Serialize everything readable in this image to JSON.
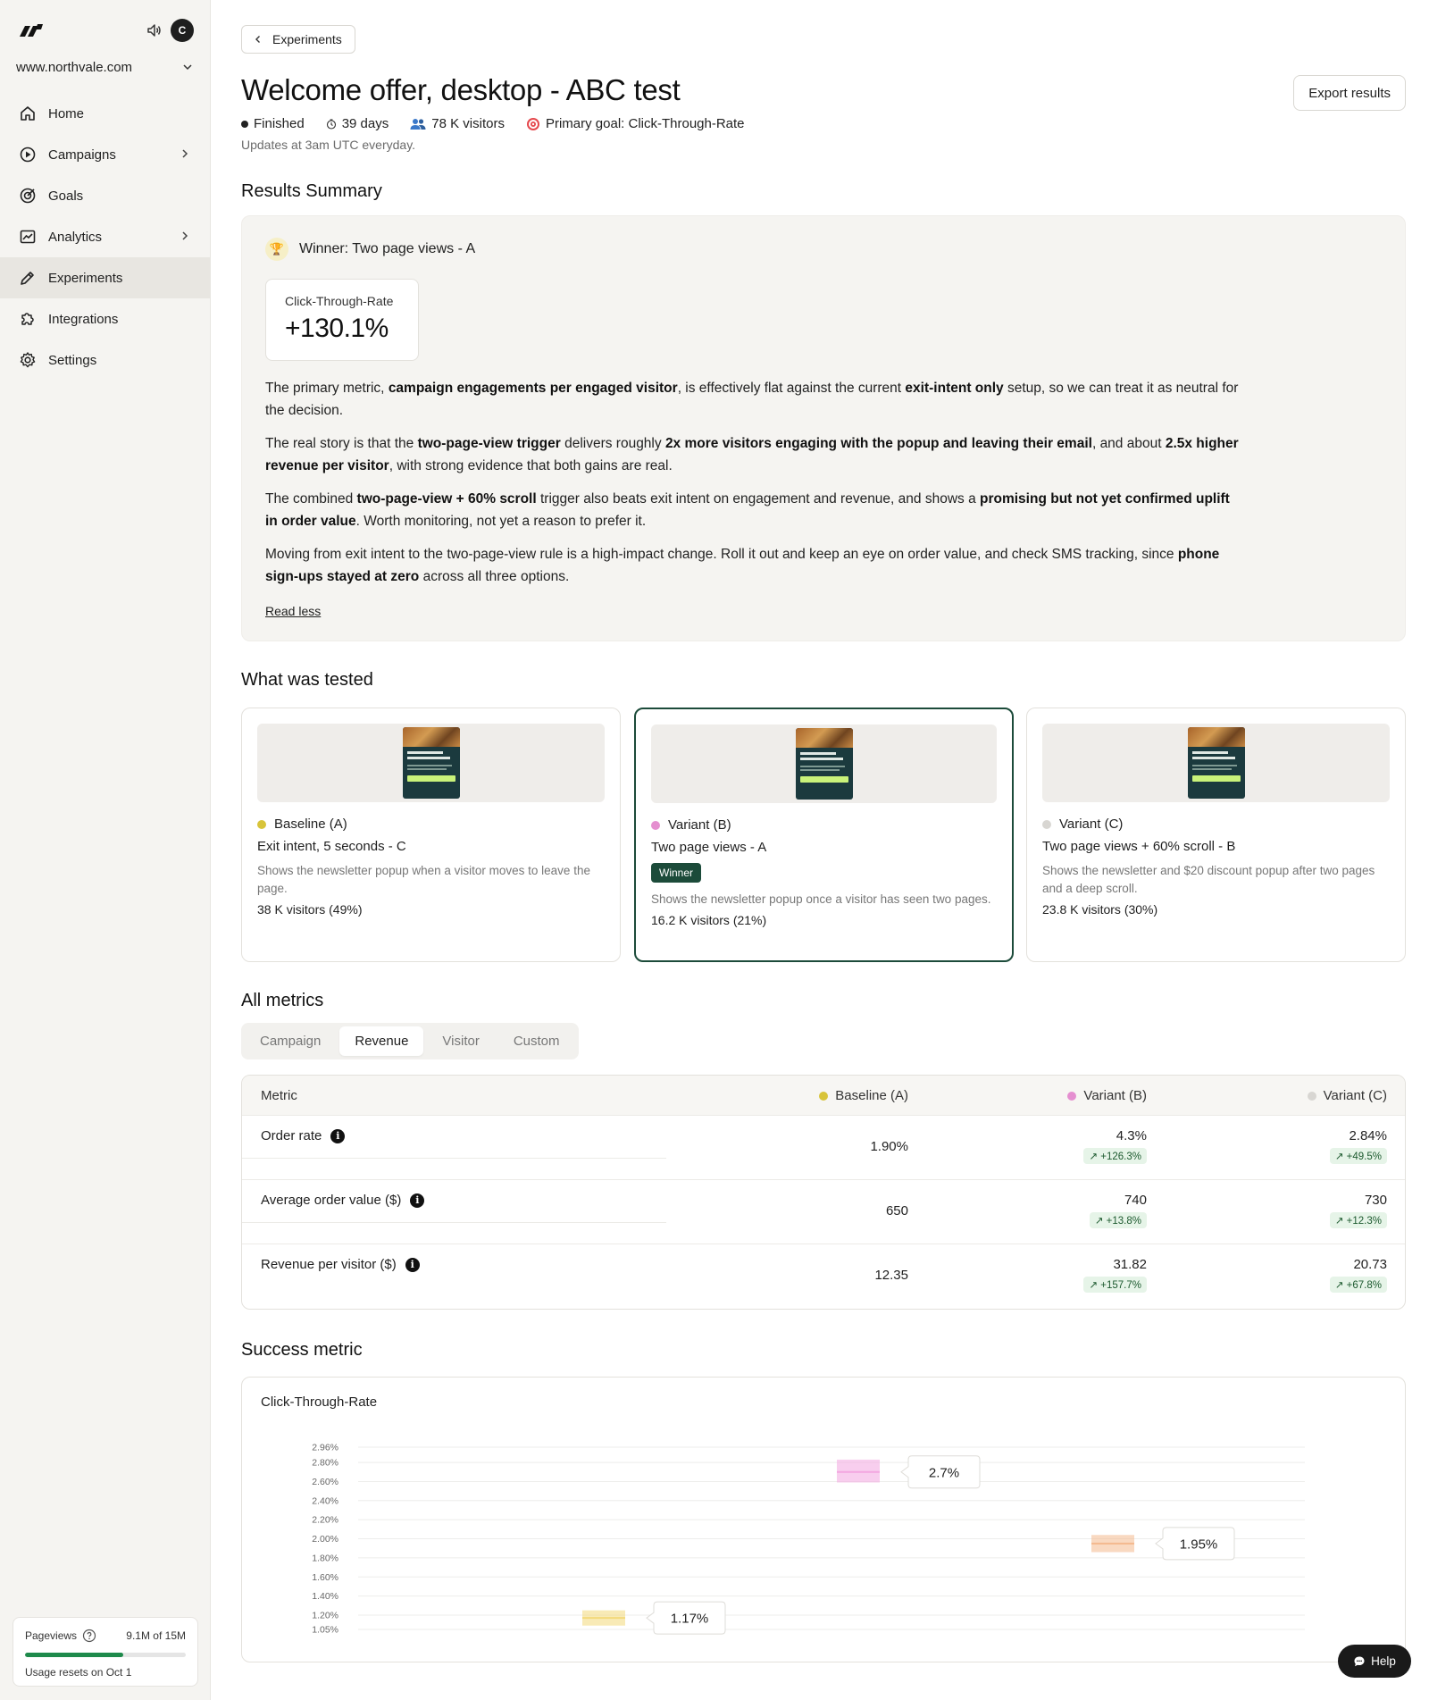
{
  "sidebar": {
    "site": "www.northvale.com",
    "avatar": "C",
    "items": [
      {
        "label": "Home",
        "icon": "home-icon"
      },
      {
        "label": "Campaigns",
        "icon": "campaigns-icon"
      },
      {
        "label": "Goals",
        "icon": "goals-icon"
      },
      {
        "label": "Analytics",
        "icon": "analytics-icon"
      },
      {
        "label": "Experiments",
        "icon": "experiments-icon"
      },
      {
        "label": "Integrations",
        "icon": "integrations-icon"
      },
      {
        "label": "Settings",
        "icon": "settings-icon"
      }
    ],
    "usage": {
      "label": "Pageviews",
      "value": "9.1M of 15M",
      "fraction": 0.61,
      "reset": "Usage resets on Oct 1"
    }
  },
  "header": {
    "back_label": "Experiments",
    "title": "Welcome offer, desktop - ABC test",
    "export_label": "Export results",
    "status": "Finished",
    "duration": "39 days",
    "visitors": "78 K visitors",
    "goal": "Primary goal: Click-Through-Rate",
    "updates": "Updates at 3am UTC everyday."
  },
  "summary": {
    "section_title": "Results Summary",
    "winner": "Winner: Two page views - A",
    "metric_label": "Click-Through-Rate",
    "metric_value": "+130.1%",
    "p1": {
      "a": "The primary metric, ",
      "b": "campaign engagements per engaged visitor",
      "c": ", is effectively flat against the current ",
      "d": "exit-intent only",
      "e": " setup, so we can treat it as neutral for the decision."
    },
    "p2": {
      "a": "The real story is that the ",
      "b": "two-page-view trigger",
      "c": " delivers roughly ",
      "d": "2x more visitors engaging with the popup and leaving their email",
      "e": ", and about ",
      "f": "2.5x higher revenue per visitor",
      "g": ", with strong evidence that both gains are real."
    },
    "p3": {
      "a": "The combined ",
      "b": "two-page-view + 60% scroll",
      "c": " trigger also beats exit intent on engagement and revenue, and shows a ",
      "d": "promising but not yet confirmed uplift in order value",
      "e": ". Worth monitoring, not yet a reason to prefer it."
    },
    "p4": {
      "a": "Moving from exit intent to the two-page-view rule is a high-impact change. Roll it out and keep an eye on order value, and check SMS tracking, since ",
      "b": "phone sign-ups stayed at zero",
      "c": " across all three options."
    },
    "read_less": "Read less"
  },
  "tested": {
    "section_title": "What was tested",
    "variants": [
      {
        "name": "Baseline (A)",
        "color": "#d8c43a",
        "sub": "Exit intent, 5 seconds - C",
        "desc": "Shows the newsletter popup when a visitor moves to leave the page.",
        "visitors": "38 K visitors (49%)"
      },
      {
        "name": "Variant (B)",
        "color": "#e58fd0",
        "sub": "Two page views - A",
        "badge": "Winner",
        "desc": "Shows the newsletter popup once a visitor has seen two pages.",
        "visitors": "16.2 K visitors (21%)"
      },
      {
        "name": "Variant (C)",
        "color": "#d8d6d2",
        "sub": "Two page views + 60% scroll - B",
        "desc": "Shows the newsletter and $20 discount popup after two pages and a deep scroll.",
        "visitors": "23.8 K visitors (30%)"
      }
    ]
  },
  "metrics": {
    "section_title": "All metrics",
    "tabs": [
      "Campaign",
      "Revenue",
      "Visitor",
      "Custom"
    ],
    "active_tab": "Revenue",
    "headers": [
      "Metric",
      "Baseline (A)",
      "Variant (B)",
      "Variant (C)"
    ],
    "rows": [
      {
        "name": "Order rate",
        "a": "1.90%",
        "b": "4.3%",
        "b_delta": "↗ +126.3%",
        "c": "2.84%",
        "c_delta": "↗ +49.5%"
      },
      {
        "name": "Average order value ($)",
        "a": "650",
        "b": "740",
        "b_delta": "↗ +13.8%",
        "c": "730",
        "c_delta": "↗ +12.3%"
      },
      {
        "name": "Revenue per visitor ($)",
        "a": "12.35",
        "b": "31.82",
        "b_delta": "↗ +157.7%",
        "c": "20.73",
        "c_delta": "↗ +67.8%"
      }
    ]
  },
  "success": {
    "section_title": "Success metric",
    "chart_title": "Click-Through-Rate"
  },
  "chart_data": {
    "type": "scatter",
    "title": "Click-Through-Rate",
    "y_ticks": [
      "2.96%",
      "2.80%",
      "2.60%",
      "2.40%",
      "2.20%",
      "2.00%",
      "1.80%",
      "1.60%",
      "1.40%",
      "1.20%",
      "1.05%"
    ],
    "y_tick_values": [
      2.96,
      2.8,
      2.6,
      2.4,
      2.2,
      2.0,
      1.8,
      1.6,
      1.4,
      1.2,
      1.05
    ],
    "ylim": [
      1.05,
      2.96
    ],
    "series": [
      {
        "name": "Baseline (A)",
        "value": 1.17,
        "label": "1.17%",
        "low": 1.09,
        "high": 1.25,
        "color": "#f3d97a"
      },
      {
        "name": "Variant (B)",
        "value": 2.7,
        "label": "2.7%",
        "low": 2.59,
        "high": 2.83,
        "color": "#f3a6e0"
      },
      {
        "name": "Variant (C)",
        "value": 1.95,
        "label": "1.95%",
        "low": 1.86,
        "high": 2.04,
        "color": "#f4b98e"
      }
    ],
    "grid": true
  },
  "help": "Help"
}
